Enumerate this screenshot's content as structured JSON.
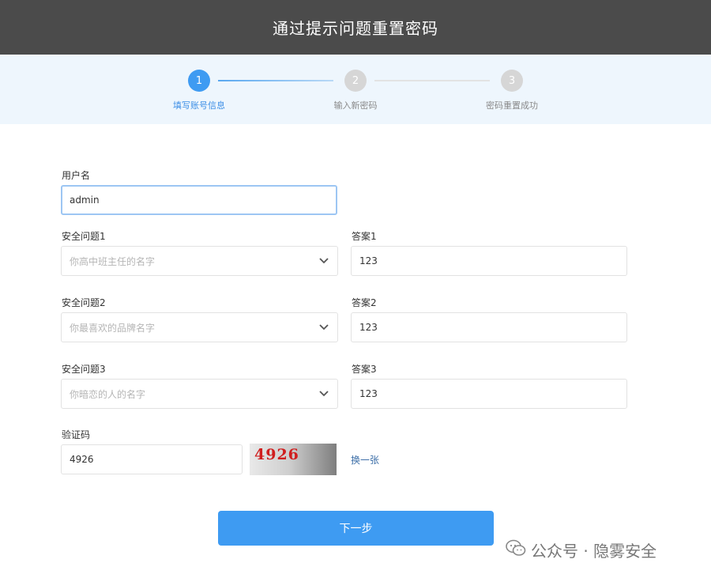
{
  "header": {
    "title": "通过提示问题重置密码"
  },
  "steps": [
    {
      "number": "1",
      "label": "填写账号信息"
    },
    {
      "number": "2",
      "label": "输入新密码"
    },
    {
      "number": "3",
      "label": "密码重置成功"
    }
  ],
  "form": {
    "username_label": "用户名",
    "username_value": "admin",
    "questions": [
      {
        "label": "安全问题1",
        "selected": "你高中班主任的名字",
        "answer_label": "答案1",
        "answer": "123"
      },
      {
        "label": "安全问题2",
        "selected": "你最喜欢的品牌名字",
        "answer_label": "答案2",
        "answer": "123"
      },
      {
        "label": "安全问题3",
        "selected": "你暗恋的人的名字",
        "answer_label": "答案3",
        "answer": "123"
      }
    ],
    "captcha_label": "验证码",
    "captcha_value": "4926",
    "captcha_image_text": "4926",
    "refresh_label": "换一张",
    "next_button": "下一步"
  },
  "watermark": {
    "text": "公众号 · 隐雾安全"
  },
  "colors": {
    "header_bg": "#4b4b4b",
    "accent": "#3e9bf2",
    "step_inactive": "#d6d6d6",
    "steps_bg": "#eef6fd"
  }
}
